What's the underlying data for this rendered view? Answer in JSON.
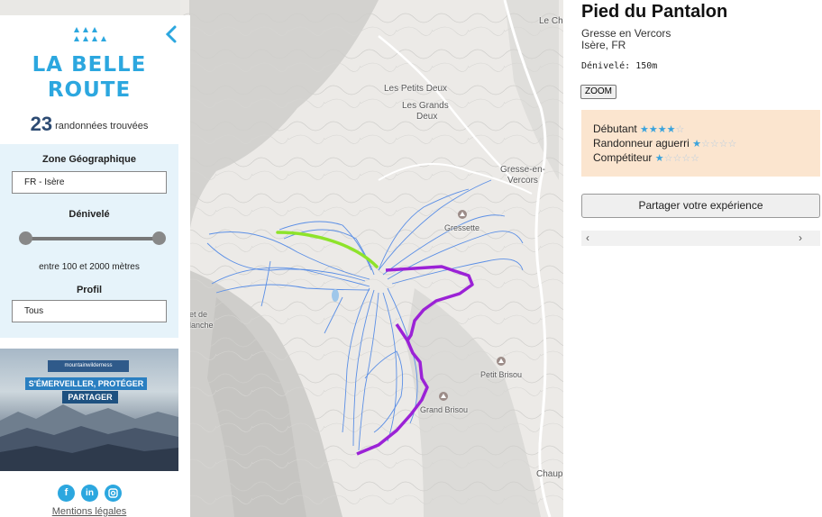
{
  "left": {
    "logo_line1": "LA BELLE",
    "logo_line2": "ROUTE",
    "result_count": "23",
    "result_label": "randonnées trouvées",
    "filters": {
      "zone_title": "Zone Géographique",
      "zone_value": "FR - Isère",
      "denivele_title": "Dénivelé",
      "denivele_min": 100,
      "denivele_max": 2000,
      "denivele_range_text": "entre 100 et 2000 mètres",
      "profil_title": "Profil",
      "profil_value": "Tous"
    },
    "ad": {
      "brand": "mountainwilderness",
      "slogan": "S'ÉMERVEILLER, PROTÉGER",
      "button": "PARTAGER"
    },
    "social": [
      "facebook-icon",
      "linkedin-icon",
      "instagram-icon"
    ],
    "mentions": "Mentions légales"
  },
  "map": {
    "labels": {
      "petits_deux": "Les Petits Deux",
      "grands_deux_1": "Les Grands",
      "grands_deux_2": "Deux",
      "gresse_1": "Gresse-en-",
      "gresse_2": "Vercors",
      "gressette": "Gressette",
      "petit_brisou": "Petit Brisou",
      "grand_brisou": "Grand Brisou",
      "le_ch": "Le Ch",
      "chaup": "Chaup",
      "et_de": "et de",
      "lanche": "lanche"
    },
    "route_colors": {
      "green": "#8ee32a",
      "purple": "#9b22d6",
      "trail": "#5b8fe6"
    }
  },
  "detail": {
    "title": "Pied du Pantalon",
    "location_1": "Gresse en Vercors",
    "location_2": "Isère, FR",
    "denivele": "Dénivelé: 150m",
    "zoom_label": "ZOOM",
    "levels": [
      {
        "label": "Débutant",
        "stars": 4,
        "max": 5
      },
      {
        "label": "Randonneur aguerri",
        "stars": 1,
        "max": 5
      },
      {
        "label": "Compétiteur",
        "stars": 1,
        "max": 5
      }
    ],
    "share_label": "Partager votre expérience",
    "scroll_left": "‹",
    "scroll_right": "›"
  }
}
